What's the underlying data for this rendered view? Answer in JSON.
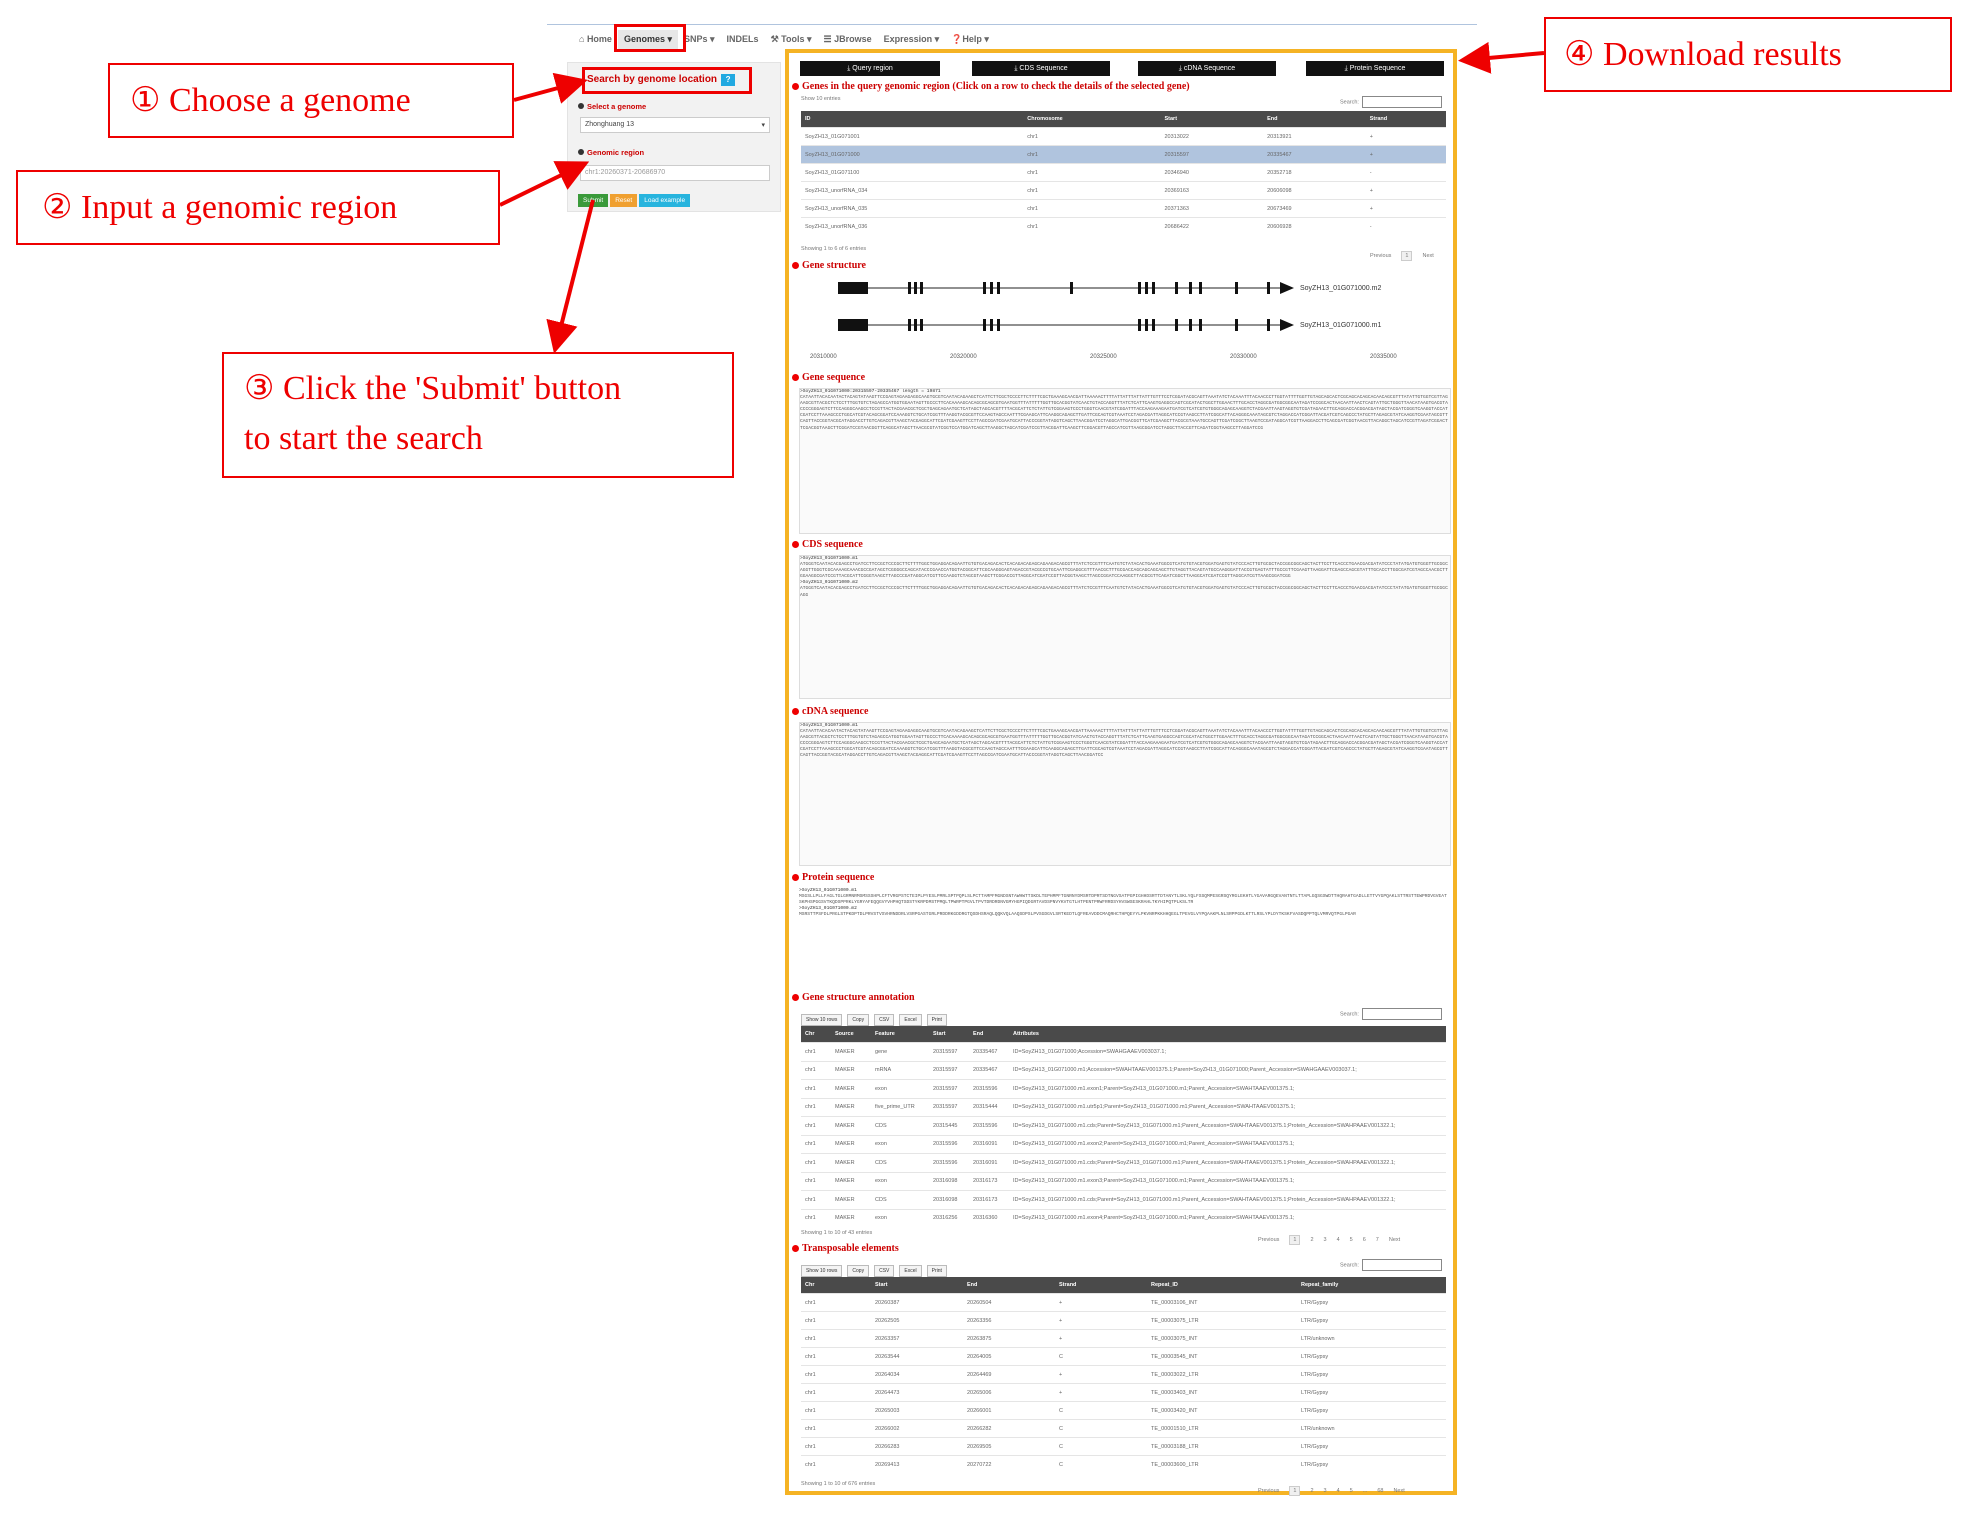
{
  "nav": {
    "items": [
      "Home",
      "Genomes",
      "SNPs",
      "INDELs",
      "Tools",
      "JBrowse",
      "Expression",
      "Help"
    ],
    "icons": [
      "home-icon",
      "",
      "",
      "",
      "tools-icon",
      "list-icon",
      "",
      "help-icon"
    ]
  },
  "sidebar": {
    "title": "Search by genome location",
    "help_label": "?",
    "genome_label": "Select a genome",
    "genome_value": "Zhonghuang 13",
    "region_label": "Genomic region",
    "region_value": "chr1:20260371-20686970",
    "submit_label": "Submit",
    "reset_label": "Reset",
    "example_label": "Load example"
  },
  "annotations": {
    "step1": "① Choose a genome",
    "step2": "② Input a genomic region",
    "step3_line1": "③ Click the 'Submit' button",
    "step3_line2": "to start the search",
    "step4": "④ Download results"
  },
  "downloads": [
    "Query region",
    "CDS Sequence",
    "cDNA Sequence",
    "Protein Sequence"
  ],
  "genes": {
    "title": "Genes in the query genomic region (Click on a row to check the details of the selected gene)",
    "show_label": "Show 10 entries",
    "search_label": "Search:",
    "columns": [
      "ID",
      "Chromosome",
      "Start",
      "End",
      "Strand"
    ],
    "rows": [
      [
        "SoyZH13_01G071001",
        "chr1",
        "20313022",
        "20313921",
        "+"
      ],
      [
        "SoyZH13_01G071000",
        "chr1",
        "20315597",
        "20335467",
        "+"
      ],
      [
        "SoyZH13_01G071100",
        "chr1",
        "20346940",
        "20352718",
        "-"
      ],
      [
        "SoyZH13_unorfRNA_034",
        "chr1",
        "20369163",
        "20606098",
        "+"
      ],
      [
        "SoyZH13_unorfRNA_035",
        "chr1",
        "20371363",
        "20673469",
        "+"
      ],
      [
        "SoyZH13_unorfRNA_036",
        "chr1",
        "20686422",
        "20606928",
        "-"
      ]
    ],
    "info": "Showing 1 to 6 of 6 entries",
    "pager": [
      "Previous",
      "1",
      "Next"
    ]
  },
  "structure": {
    "title": "Gene structure",
    "transcripts": [
      "SoyZH13_01G071000.m2",
      "SoyZH13_01G071000.m1"
    ],
    "axis": [
      "20310000",
      "20320000",
      "20325000",
      "20330000",
      "20335000"
    ]
  },
  "gene_seq": {
    "title": "Gene sequence",
    "header": ">SoyZH13_01G071000:20315597-20335467 length = 19871",
    "body": "CATAATTACACAATACTACAGTATAAGTTCCGAGTAGAAGAGGCAAGTGCGTCAATACAGAAGCTCATTCTTCGCTCCCCTTCTTTTCGCTGAAAGCAACGATTAAAAACTTTTATTATTTATTATTTGTTTCCTCGGATACGCAGTTAAATATCTACAAATTTACAACCCTTGGTATTTTGGTTGTAGCAGCACTCGCAGCACAGCACAACAGCGTTTATATTGTGGTCGTTAGAAGCGTTACGCTCTCCTTTGGTGTCTAGAGCCATGGTGGAATAGTTGCCCTTCACAAAAGCACAGCGCAGCGTGAATGGTTTATTTTTGGTTGCACGGTATCAACTGTACCAGGTTTATCTCATTCAAGTGAGGCCAGTCGCATACTGGCTTGGAACTTTGCACCTAGGCGATGGCGGCAATAGATCCGGCACTAACAATTAACTCAGTATTGCTGGGTTAACATAAGTGACGTACCCCGGGAGTCTTCCAGGGCAAGCCTCCGTTACTACGAACGCTCGCTGAGCAGAATGCTCATAGCTAGCACGTTTTACGCATTCTCTATTGTCGGAAGTCCCTGGGTCAACGTATCGGATTTACCAAGAAAGAATGATCGTCATCGTGTGGGCAGAGCAAGGTCTACGAATTAAGTAGGTGTCGATAGAACTTGCAGGACCACGGACGATAGCTACGATCGGGTCAAGGTACCATCGATCCTTAAAGCCCTGGCATCGTACAGCGGATCCAAAGGTCTGCATCGGTTTAAGGTACGCGTTCCAAGTAGCCAATTTCGAAGCATTCAAGGCAGAGCTTGATTCGCAGTCGTAAATCCTAGACGATTAGGCATCCGTAAGCCTTATCGGCATTACAGGGCAAATAGCGTCTAGGACCATCGGATTACGATCGTCAGCCCTATGCTTAGAGCGTATCAAGGTCGAATAGCGTTCAGTTACCGGTACGCATAGGACCTTGTCAGACGTTAAGCTACGAGGCATTCGATCGAAGTTCCTTAGCCGATCGAATGCATTACCCGGTATAGGTCAGCTTAACGGATCCTAGGCATTGACGGTTCATCGAAGCTTACGCGTAAATGCCAGTTCGATCGGCTTAAGTCCGATAGGCATCGTTAAGGACCTTCAGCGATCGGTAACGTTACAGGCTAGCATCCGTTAGATCGGACTTCGACGGTAAGCTTCGGATCCGTAACGGTTCAGGCATAGCTTAACGCGTATCGGTCCATGGATCAGCTTAAGGCTAGCATCGATCCGTTACGGATTCAAGCTTCGGACGTTAGCCATCGTTAAGCGGATCCTAGGCTTACCGTTCAGATCGGTAAGCCTTAGGATCCG"
  },
  "cds_seq": {
    "title": "CDS sequence",
    "header1": ">SoyZH13_01G071000.m1",
    "body1": "ATGGGTCAATACACGAGCCTGATCCTTCCGCTCCCGCTTCTTTTGGCTGGAGGACAGAATTGTGTGACAGACACTCACAGACAGAGCAGAAGACAGCGTTTATCTCCGTTTCAATGTCTATACACTGAAATGGCGTCATGTGTACGTGGATGAGTGTATCCCACTTGTGCGCTACCGGCGGCAGCTACTTCCTTCACCCTGAACGACGATATCCCTATATGATGTGGGTTGCGGCAGGTTGGGTCGCAAAAGCAAACGCCGATAGCTCGGGGCCAGCATACCCGAACCATGGTACGGCATTCGCAAGGGAGTAGACCGTACGCCGTGCAATTCGAGGCGTTTAACGCTTTGCGACCAGCAGCAGCAGCTTGTAGGTTACAGTATGCCAAGGGATTACCGTGAGTATTTGCCGTTCGAAGTTAAGGATTCGAGCCAGCGTATTTGCACCTTGGCGATCGTAGCCAACGCTTGGAAGGCGATCCGTTACGCATTCGGGTAAGCTTAGCCCGATAGGCATCGTTCCAAGGTCTAGCGTAAGCTTCGGACCGTTAGGCATCGATCCGTTACGGTAAGCTTAGCCGGATCCAAGGCTTACGCGTTCAGATCGGCTTAAGGCATCGATCCGTTAGGCATCGTTAAGCGGATCGG",
    "header2": ">SoyZH13_01G071000.m2",
    "body2": "ATGGGTCAATACACGAGCCTGATCCTTCCGCTCCCGCTTCTTTTGGCTGGAGGACAGAATTGTGTGACAGACACTCACAGACAGAGCAGAAGACAGCGTTTATCTCCGTTTCAATGTCTATACACTGAAATGGCGTCATGTGTACGTGGATGAGTGTATCCCACTTGTGCGCTACCGGCGGCAGCTACTTCCTTCACCCTGAACGACGATATCCCTATATGATGTGGGTTGCGGCAGG"
  },
  "cdna_seq": {
    "title": "cDNA sequence",
    "header": ">SoyZH13_01G071000.m1",
    "body": "CATAATTACACAATACTACAGTATAAGTTCCGAGTAGAAGAGGCAAGTGCGTCAATACAGAAGCTCATTCTTCGCTCCCCTTCTTTTCGCTGAAAGCAACGATTAAAAACTTTTATTATTTATTATTTGTTTCCTCGGATACGCAGTTAAATATCTACAAATTTACAACCCTTGGTATTTTGGTTGTAGCAGCACTCGCAGCACAGCACAACAGCGTTTATATTGTGGTCGTTAGAAGCGTTACGCTCTCCTTTGGTGTCTAGAGCCATGGTGGAATAGTTGCCCTTCACAAAAGCACAGCGCAGCGTGAATGGTTTATTTTTGGTTGCACGGTATCAACTGTACCAGGTTTATCTCATTCAAGTGAGGCCAGTCGCATACTGGCTTGGAACTTTGCACCTAGGCGATGGCGGCAATAGATCCGGCACTAACAATTAACTCAGTATTGCTGGGTTAACATAAGTGACGTACCCCGGGAGTCTTCCAGGGCAAGCCTCCGTTACTACGAACGCTCGCTGAGCAGAATGCTCATAGCTAGCACGTTTTACGCATTCTCTATTGTCGGAAGTCCCTGGGTCAACGTATCGGATTTACCAAGAAAGAATGATCGTCATCGTGTGGGCAGAGCAAGGTCTACGAATTAAGTAGGTGTCGATAGAACTTGCAGGACCACGGACGATAGCTACGATCGGGTCAAGGTACCATCGATCCTTAAAGCCCTGGCATCGTACAGCGGATCCAAAGGTCTGCATCGGTTTAAGGTACGCGTTCCAAGTAGCCAATTTCGAAGCATTCAAGGCAGAGCTTGATTCGCAGTCGTAAATCCTAGACGATTAGGCATCCGTAAGCCTTATCGGCATTACAGGGCAAATAGCGTCTAGGACCATCGGATTACGATCGTCAGCCCTATGCTTAGAGCGTATCAAGGTCGAATAGCGTTCAGTTACCGGTACGCATAGGACCTTGTCAGACGTTAAGCTACGAGGCATTCGATCGAAGTTCCTTAGCCGATCGAATGCATTACCCGGTATAGGTCAGCTTAACGGATCC"
  },
  "protein_seq": {
    "title": "Protein sequence",
    "header1": ">SoyZH13_01G071000.m1",
    "body1": "MSGSLLPLLFAGLTGLGRMNRMSMSSSHPLCFTVRGPSTCTEIPLPYESLPMRLSPTPQPLSLPCTTAMPFMGNDSNTAWHWTTSKDLTEPHMPFTGNRNYDMSRTDPRTSDTNGVSATPGPIGHHDSRTTDTANYTLSKLYQLFSSQMPESGRSQYRGLEKHTLYGAVARGQEVANTNTLTTAPLGQSGSWDTTHQRAHTGADLLETTVYGPQAKLSTTRSTTEWPRDVGVEATSKPHSPGGSVTKQDSPPRKLYGRYAFEQQGVYVHPHQTSDSTYKRPDMSTPMQLTPWRPTPGVLTPVTDRDRDNVGMYHGPIQDGRTAVDSPNVYKVTGTLHTPENTPRWFRRDSYHVSWSESKRAHLTKYHIPQTPLKSLTR",
    "header2": ">SoyZH13_01G071000.m2",
    "body2": "MSRSTTPSFDLPRGLSTPKDPTDLPRVSTVSVHRNDDRLVSRPGASTGRLPRDDRKGDDRGTQSDHSRAQLQQKVQLAAQSDPSLPVSGDGVLSRTKEDTLQFREAVDDCMAQRHCTHPQEYYLPKVNRPKKHHQEGLTPEVGLVYPQAAKPLNLSRPPGDLKTTLRSLYPLDYTKSKFVASDQPPTQLVMRVQTPGLPGAR"
  },
  "annotation": {
    "title": "Gene structure annotation",
    "buttons": [
      "Show 10 rows",
      "Copy",
      "CSV",
      "Excel",
      "Print"
    ],
    "search_label": "Search:",
    "columns": [
      "Chr",
      "Source",
      "Feature",
      "Start",
      "End",
      "Attributes"
    ],
    "rows": [
      [
        "chr1",
        "MAKER",
        "gene",
        "20315597",
        "20335467",
        "ID=SoyZH13_01G071000;Accession=SWAHGAAEV003037.1;"
      ],
      [
        "chr1",
        "MAKER",
        "mRNA",
        "20315597",
        "20335467",
        "ID=SoyZH13_01G071000.m1;Accession=SWAHTAAEV001375.1;Parent=SoyZH13_01G071000;Parent_Accession=SWAHGAAEV003037.1;"
      ],
      [
        "chr1",
        "MAKER",
        "exon",
        "20315597",
        "20315596",
        "ID=SoyZH13_01G071000.m1.exon1;Parent=SoyZH13_01G071000.m1;Parent_Accession=SWAHTAAEV001375.1;"
      ],
      [
        "chr1",
        "MAKER",
        "five_prime_UTR",
        "20315597",
        "20315444",
        "ID=SoyZH13_01G071000.m1.utr5p1;Parent=SoyZH13_01G071000.m1;Parent_Accession=SWAHTAAEV001375.1;"
      ],
      [
        "chr1",
        "MAKER",
        "CDS",
        "20315445",
        "20315596",
        "ID=SoyZH13_01G071000.m1.cds;Parent=SoyZH13_01G071000.m1;Parent_Accession=SWAHTAAEV001375.1;Protein_Accession=SWAHPAAEV001322.1;"
      ],
      [
        "chr1",
        "MAKER",
        "exon",
        "20315596",
        "20316091",
        "ID=SoyZH13_01G071000.m1.exon2;Parent=SoyZH13_01G071000.m1;Parent_Accession=SWAHTAAEV001375.1;"
      ],
      [
        "chr1",
        "MAKER",
        "CDS",
        "20315596",
        "20316091",
        "ID=SoyZH13_01G071000.m1.cds;Parent=SoyZH13_01G071000.m1;Parent_Accession=SWAHTAAEV001375.1;Protein_Accession=SWAHPAAEV001322.1;"
      ],
      [
        "chr1",
        "MAKER",
        "exon",
        "20316098",
        "20316173",
        "ID=SoyZH13_01G071000.m1.exon3;Parent=SoyZH13_01G071000.m1;Parent_Accession=SWAHTAAEV001375.1;"
      ],
      [
        "chr1",
        "MAKER",
        "CDS",
        "20316098",
        "20316173",
        "ID=SoyZH13_01G071000.m1.cds;Parent=SoyZH13_01G071000.m1;Parent_Accession=SWAHTAAEV001375.1;Protein_Accession=SWAHPAAEV001322.1;"
      ],
      [
        "chr1",
        "MAKER",
        "exon",
        "20316256",
        "20316360",
        "ID=SoyZH13_01G071000.m1.exon4;Parent=SoyZH13_01G071000.m1;Parent_Accession=SWAHTAAEV001375.1;"
      ]
    ],
    "info": "Showing 1 to 10 of 43 entries",
    "pager": [
      "Previous",
      "1",
      "2",
      "3",
      "4",
      "5",
      "6",
      "7",
      "Next"
    ]
  },
  "te": {
    "title": "Transposable elements",
    "buttons": [
      "Show 10 rows",
      "Copy",
      "CSV",
      "Excel",
      "Print"
    ],
    "search_label": "Search:",
    "columns": [
      "Chr",
      "Start",
      "End",
      "Strand",
      "Repeat_ID",
      "Repeat_family"
    ],
    "rows": [
      [
        "chr1",
        "20260387",
        "20260504",
        "+",
        "TE_00003106_INT",
        "LTR/Gypsy"
      ],
      [
        "chr1",
        "20262505",
        "20263356",
        "+",
        "TE_00003075_LTR",
        "LTR/Gypsy"
      ],
      [
        "chr1",
        "20263357",
        "20263875",
        "+",
        "TE_00003075_INT",
        "LTR/unknown"
      ],
      [
        "chr1",
        "20263544",
        "20264005",
        "C",
        "TE_00003545_INT",
        "LTR/Gypsy"
      ],
      [
        "chr1",
        "20264034",
        "20264469",
        "+",
        "TE_00003022_LTR",
        "LTR/Gypsy"
      ],
      [
        "chr1",
        "20264473",
        "20265006",
        "+",
        "TE_00003403_INT",
        "LTR/Gypsy"
      ],
      [
        "chr1",
        "20265003",
        "20266001",
        "C",
        "TE_00003420_INT",
        "LTR/Gypsy"
      ],
      [
        "chr1",
        "20266002",
        "20266282",
        "C",
        "TE_00001510_LTR",
        "LTR/unknown"
      ],
      [
        "chr1",
        "20266283",
        "20269505",
        "C",
        "TE_00003188_LTR",
        "LTR/Gypsy"
      ],
      [
        "chr1",
        "20269413",
        "20270722",
        "C",
        "TE_00003600_LTR",
        "LTR/Gypsy"
      ]
    ],
    "info": "Showing 1 to 10 of 676 entries",
    "pager": [
      "Previous",
      "1",
      "2",
      "3",
      "4",
      "5",
      "...",
      "68",
      "Next"
    ]
  },
  "colors": {
    "annotation_red": "#e00000",
    "frame_orange": "#f5b324",
    "table_header": "#4a4a4a",
    "selected_row": "#b0c4de"
  }
}
